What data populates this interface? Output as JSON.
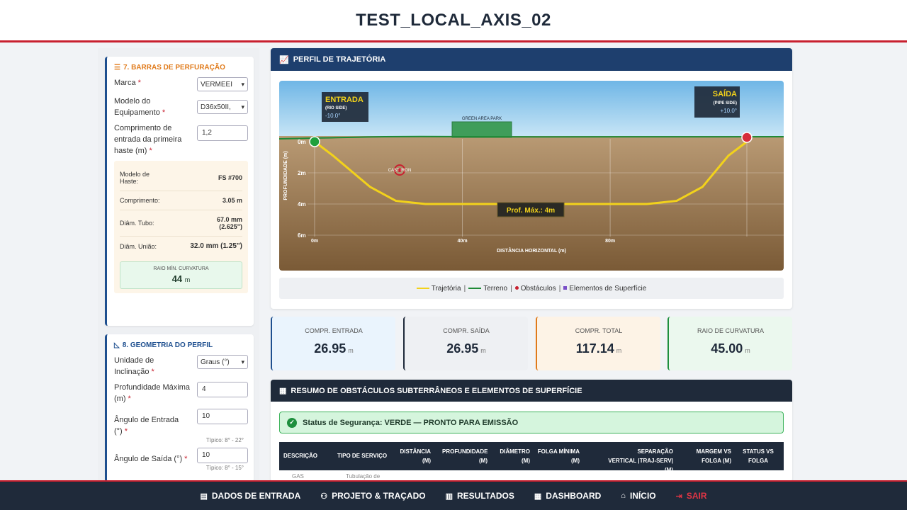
{
  "header": {
    "title": "TEST_LOCAL_AXIS_02"
  },
  "barras": {
    "title": "7. BARRAS DE PERFURAÇÃO",
    "marca_label": "Marca",
    "marca_value": "VERMEEI",
    "modelo_label": "Modelo do Equipamento",
    "modelo_value": "D36x50II,",
    "comprimento_label": "Comprimento de entrada da primeira haste (m)",
    "comprimento_value": "1,2",
    "specs": [
      {
        "label": "Modelo de Haste:",
        "value": "FS #700"
      },
      {
        "label": "Comprimento:",
        "value": "3.05 m"
      },
      {
        "label": "Diâm. Tubo:",
        "value": "67.0 mm (2.625\")"
      },
      {
        "label": "Diâm. União:",
        "value": "32.0 mm (1.25\")"
      }
    ],
    "raio_label": "RAIO MÍN. CURVATURA",
    "raio_value": "44",
    "raio_unit": "m"
  },
  "geometria": {
    "title": "8. GEOMETRIA DO PERFIL",
    "unidade_label": "Unidade de Inclinação",
    "unidade_value": "Graus (°)",
    "prof_label": "Profundidade Máxima (m)",
    "prof_value": "4",
    "ang_entrada_label": "Ângulo de Entrada (°)",
    "ang_entrada_value": "10",
    "ang_entrada_hint": "Típico: 8° - 22°",
    "ang_saida_label": "Ângulo de Saída (°)",
    "ang_saida_value": "10",
    "ang_saida_hint": "Típico: 8° - 15°"
  },
  "profile_panel": {
    "title": "PERFIL DE TRAJETÓRIA",
    "entrada": {
      "title": "ENTRADA",
      "sub": "(RIO SIDE)",
      "angle": "-10.0°"
    },
    "saida": {
      "title": "SAÍDA",
      "sub": "(PIPE SIDE)",
      "angle": "+10.0°"
    },
    "surface_label": "GREEN AREA PARK",
    "obstacle_label": "CAST IRON",
    "max_label": "Prof. Máx.: 4m",
    "y_axis_label": "PROFUNDIDADE (m)",
    "x_axis_label": "DISTÂNCIA HORIZONTAL (m)",
    "legend": {
      "trajetoria": "Trajetória",
      "terreno": "Terreno",
      "obstaculos": "Obstáculos",
      "elementos": "Elementos de Superfície"
    }
  },
  "chart_data": {
    "type": "line",
    "xlabel": "DISTÂNCIA HORIZONTAL (m)",
    "ylabel": "PROFUNDIDADE (m)",
    "x_ticks": [
      "0m",
      "40m",
      "80m"
    ],
    "y_ticks": [
      "0m",
      "2m",
      "4m",
      "6m"
    ],
    "xlim": [
      0,
      117
    ],
    "ylim": [
      0,
      6.5
    ],
    "series": [
      {
        "name": "Trajetória",
        "x": [
          0,
          5,
          15,
          22,
          30,
          60,
          90,
          98,
          105,
          112,
          117
        ],
        "y": [
          0,
          0.9,
          2.9,
          3.8,
          4,
          4,
          4,
          3.8,
          2.9,
          0.9,
          0
        ]
      }
    ],
    "terrain_color": "#1f8a36",
    "trajectory_color": "#f2d21b",
    "obstacle_color": "#c8202f"
  },
  "stats": [
    {
      "label": "COMPR. ENTRADA",
      "value": "26.95",
      "unit": "m"
    },
    {
      "label": "COMPR. SAÍDA",
      "value": "26.95",
      "unit": "m"
    },
    {
      "label": "COMPR. TOTAL",
      "value": "117.14",
      "unit": "m"
    },
    {
      "label": "RAIO DE CURVATURA",
      "value": "45.00",
      "unit": "m"
    }
  ],
  "obstacles": {
    "title": "RESUMO DE OBSTÁCULOS SUBTERRÂNEOS E ELEMENTOS DE SUPERFÍCIE",
    "status": "Status de Segurança: VERDE — PRONTO PARA EMISSÃO",
    "columns": [
      "DESCRIÇÃO",
      "TIPO DE SERVIÇO",
      "DISTÂNCIA (M)",
      "PROFUNDIDADE (M)",
      "DIÂMETRO (M)",
      "FOLGA MÍNIMA (M)",
      "SEPARAÇÃO VERTICAL |TRAJ-SERV| (M)",
      "MARGEM VS FOLGA (M)",
      "STATUS VS FOLGA"
    ],
    "row_partial": [
      "GAS",
      "Tubulação de"
    ]
  },
  "nav": [
    {
      "label": "DADOS DE ENTRADA",
      "icon": "document-icon"
    },
    {
      "label": "PROJETO & TRAÇADO",
      "icon": "network-icon"
    },
    {
      "label": "RESULTADOS",
      "icon": "chart-icon"
    },
    {
      "label": "DASHBOARD",
      "icon": "grid-icon"
    },
    {
      "label": "INÍCIO",
      "icon": "home-icon"
    },
    {
      "label": "SAIR",
      "icon": "logout-icon"
    }
  ]
}
